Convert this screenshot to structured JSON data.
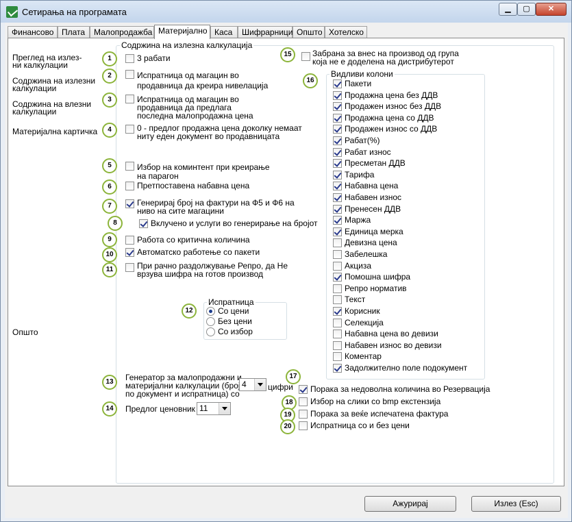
{
  "window": {
    "title": "Сетирања на програмата"
  },
  "tabs": [
    "Финансово",
    "Плата",
    "Малопродажба",
    "Материјално",
    "Каса",
    "Шифрарници",
    "Општо",
    "Хотелско"
  ],
  "left_labels": {
    "pregled": "Преглед на излез-\nни калкулации",
    "sodrzina_izlezni": "Содржина на излезни\nкалкулации",
    "sodrzina_vlezni": "Содржина на влезни\nкалкулации",
    "materijalna": "Материјална картичка",
    "opsto": "Општо"
  },
  "group_izlezna": {
    "title": "Содржина на излезна калкулација"
  },
  "options": [
    {
      "num": "1",
      "text": "3 рабати",
      "checked": false
    },
    {
      "num": "2",
      "text": "Испратница од магацин во\nпродавница да креира нивелација",
      "checked": false
    },
    {
      "num": "3",
      "text": "Испратница од магацин во\nпродавница да предлага\nпоследна малопродажна цена",
      "checked": false
    },
    {
      "num": "4",
      "text": "0 - предлог продажна цена доколку немаат\nниту еден документ во продавницата",
      "checked": false
    },
    {
      "num": "5",
      "text": "Избор на коминтент при креирање\nна парагон",
      "checked": false
    },
    {
      "num": "6",
      "text": "Претпоставена набавна цена",
      "checked": false
    },
    {
      "num": "7",
      "text": "Генерирај број на фактури на Ф5 и Ф6 на\nниво на сите магацини",
      "checked": true
    },
    {
      "num": "8",
      "text": "Вклучено и услуги во генерирање на бројот",
      "checked": true
    },
    {
      "num": "9",
      "text": "Работа со критична количина",
      "checked": false
    },
    {
      "num": "10",
      "text": "Автоматско работење со пакети",
      "checked": true
    },
    {
      "num": "11",
      "text": "При рачно раздолжување Репро, да Не\nврзува шифра на готов производ",
      "checked": false
    }
  ],
  "ispratnica": {
    "num": "12",
    "title": "Испратница",
    "options": [
      {
        "label": "Со цени",
        "selected": true
      },
      {
        "label": "Без цени",
        "selected": false
      },
      {
        "label": "Со избор",
        "selected": false
      }
    ]
  },
  "generator": {
    "num": "13",
    "label": "Генератор за малопродажни и\nматеријални калкулации (број,\nпо документ и испратница) со",
    "value": "4",
    "suffix": "цифри"
  },
  "cenovnik": {
    "num": "14",
    "label": "Предлог ценовник",
    "value": "11"
  },
  "zabrana": {
    "num": "15",
    "text": "Забрана за внес на производ од група\nкоја не е доделена на дистрибутерот",
    "checked": false
  },
  "vidlivi": {
    "num": "16",
    "title": "Видливи колони",
    "columns": [
      {
        "label": "Пакети",
        "checked": true
      },
      {
        "label": "Продажна цена без ДДВ",
        "checked": true
      },
      {
        "label": "Продажен износ без ДДВ",
        "checked": true
      },
      {
        "label": "Продажна цена со ДДВ",
        "checked": true
      },
      {
        "label": "Продажен износ со ДДВ",
        "checked": true
      },
      {
        "label": "Рабат(%)",
        "checked": true
      },
      {
        "label": "Рабат износ",
        "checked": true
      },
      {
        "label": "Пресметан ДДВ",
        "checked": true
      },
      {
        "label": "Тарифа",
        "checked": true
      },
      {
        "label": "Набавна цена",
        "checked": true
      },
      {
        "label": "Набавен износ",
        "checked": true
      },
      {
        "label": "Пренесен ДДВ",
        "checked": true
      },
      {
        "label": "Маржа",
        "checked": true
      },
      {
        "label": "Единица мерка",
        "checked": true
      },
      {
        "label": "Девизна цена",
        "checked": false
      },
      {
        "label": "Забелешка",
        "checked": false
      },
      {
        "label": "Акциза",
        "checked": false
      },
      {
        "label": "Помошна шифра",
        "checked": true
      },
      {
        "label": "Репро норматив",
        "checked": false
      },
      {
        "label": "Текст",
        "checked": false
      },
      {
        "label": "Корисник",
        "checked": true
      },
      {
        "label": "Селекција",
        "checked": false
      },
      {
        "label": "Набавна цена во девизи",
        "checked": false
      },
      {
        "label": "Набавен износ  во девизи",
        "checked": false
      },
      {
        "label": "Коментар",
        "checked": false
      },
      {
        "label": "Задолжително поле подокумент",
        "checked": true
      }
    ]
  },
  "bottom_options": [
    {
      "num": "17",
      "text": "Порака за недоволна количина во Резервација",
      "checked": true
    },
    {
      "num": "18",
      "text": "Избор на слики со bmp екстензија",
      "checked": false
    },
    {
      "num": "19",
      "text": "Порака за веќе испечатена фактура",
      "checked": false
    },
    {
      "num": "20",
      "text": "Испратница со и без цени",
      "checked": false
    }
  ],
  "buttons": {
    "update": "Ажурирај",
    "exit": "Излез (Esc)"
  }
}
